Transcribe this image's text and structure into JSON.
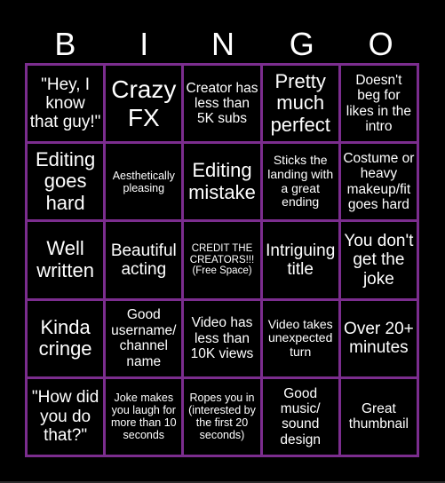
{
  "header": {
    "letters": [
      "B",
      "I",
      "N",
      "G",
      "O"
    ]
  },
  "colors": {
    "background": "#000000",
    "grid_line": "#7b2d8e",
    "text": "#ffffff"
  },
  "cells": [
    "\"Hey, I know that guy!\"",
    "Crazy FX",
    "Creator has less than 5K subs",
    "Pretty much perfect",
    "Doesn't beg for likes in the intro",
    "Editing goes hard",
    "Aesthetically pleasing",
    "Editing mistake",
    "Sticks the landing with a great ending",
    "Costume or heavy makeup/fit goes hard",
    "Well written",
    "Beautiful acting",
    "CREDIT THE CREATORS!!! (Free Space)",
    "Intriguing title",
    "You don't get the joke",
    "Kinda cringe",
    "Good username/ channel name",
    "Video has less than 10K views",
    "Video takes unexpected turn",
    "Over 20+ minutes",
    "\"How did you do that?\"",
    "Joke makes you laugh for more than 10 seconds",
    "Ropes you in (interested by the first 20 seconds)",
    "Good music/ sound design",
    "Great thumbnail"
  ]
}
